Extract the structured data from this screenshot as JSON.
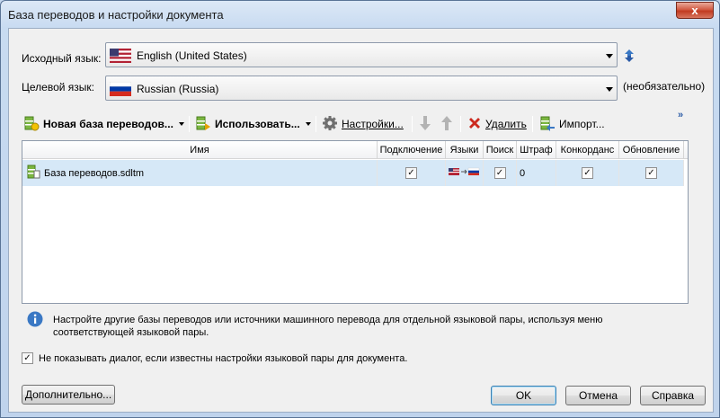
{
  "window": {
    "title": "База переводов и настройки документа",
    "close_glyph": "x"
  },
  "source": {
    "label": "Исходный язык:",
    "value": "English (United States)",
    "flag": "us-flag"
  },
  "target": {
    "label": "Целевой язык:",
    "value": "Russian (Russia)",
    "flag": "ru-flag",
    "optional_note": "(необязательно)"
  },
  "toolbar": {
    "new_tm": "Новая база переводов...",
    "use": "Использовать...",
    "settings": "Настройки...",
    "remove": "Удалить",
    "import": "Импорт...",
    "more": "»"
  },
  "grid": {
    "columns": [
      "Имя",
      "Подключение",
      "Языки",
      "Поиск",
      "Штраф",
      "Конкорданс",
      "Обновление"
    ],
    "rows": [
      {
        "name": "База переводов.sdltm",
        "enabled": true,
        "languages": "en-US → ru-RU",
        "lookup": true,
        "penalty": "0",
        "concordance": true,
        "update": true
      }
    ]
  },
  "info": {
    "text": "Настройте другие базы переводов или источники машинного перевода для отдельной языковой пары, используя меню соответствующей языковой пары."
  },
  "dont_show": {
    "checked": true,
    "label": "Не показывать диалог, если известны настройки языковой пары для документа."
  },
  "buttons": {
    "advanced": "Дополнительно...",
    "ok": "OK",
    "cancel": "Отмена",
    "help": "Справка"
  },
  "colors": {
    "accent": "#3c7fb1",
    "selection": "#d6e8f7",
    "remove_red": "#cc2a1f"
  }
}
